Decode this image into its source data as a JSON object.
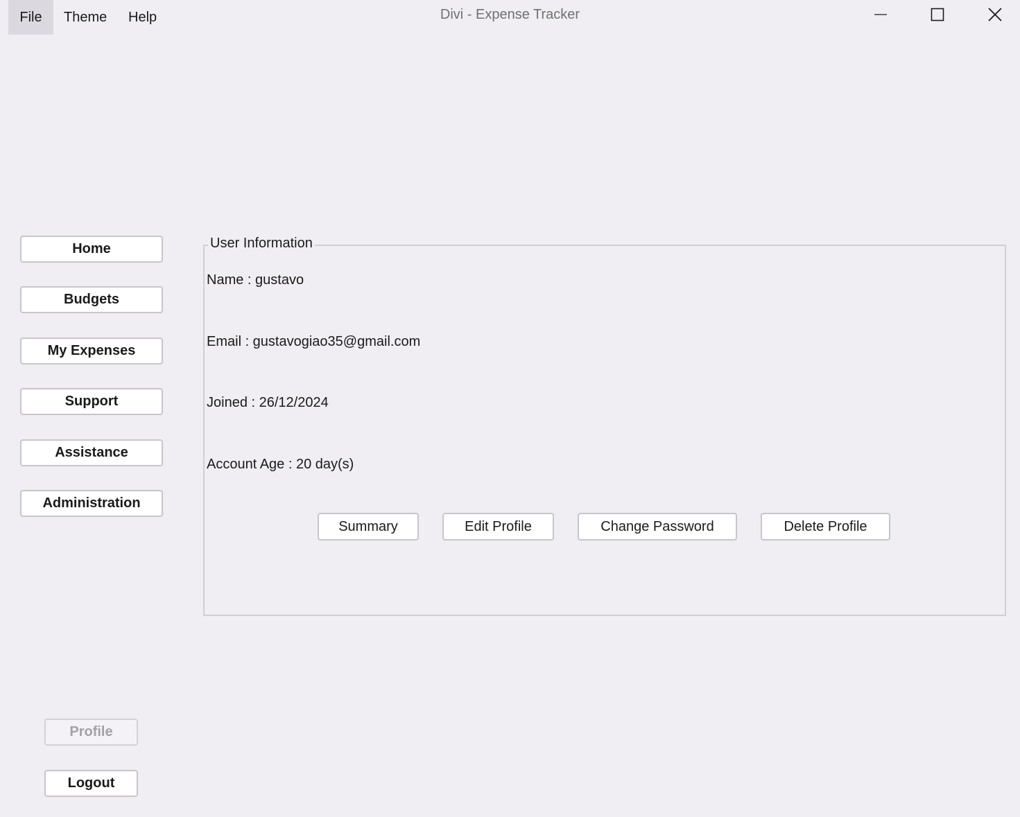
{
  "window": {
    "title": "Divi - Expense Tracker"
  },
  "menu": {
    "items": [
      "File",
      "Theme",
      "Help"
    ],
    "active": "File"
  },
  "window_controls": {
    "icons": [
      "minimize-icon",
      "maximize-icon",
      "close-icon"
    ]
  },
  "sidebar": {
    "items": [
      {
        "label": "Home"
      },
      {
        "label": "Budgets"
      },
      {
        "label": "My Expenses"
      },
      {
        "label": "Support"
      },
      {
        "label": "Assistance"
      },
      {
        "label": "Administration"
      }
    ],
    "profile_label": "Profile",
    "profile_disabled": true,
    "logout_label": "Logout"
  },
  "user_info": {
    "group_title": "User Information",
    "name_line": "Name : gustavo",
    "email_line": "Email : gustavogiao35@gmail.com",
    "joined_line": "Joined : 26/12/2024",
    "age_line": "Account Age : 20 day(s)"
  },
  "actions": {
    "summary_label": "Summary",
    "edit_label": "Edit Profile",
    "password_label": "Change Password",
    "delete_label": "Delete Profile"
  },
  "colors": {
    "background": "#f0eef3",
    "button_bg": "#ffffff",
    "button_border": "#c8c4cc",
    "disabled_text": "#a3a1a6",
    "active_menu": "#dcd8e0"
  }
}
